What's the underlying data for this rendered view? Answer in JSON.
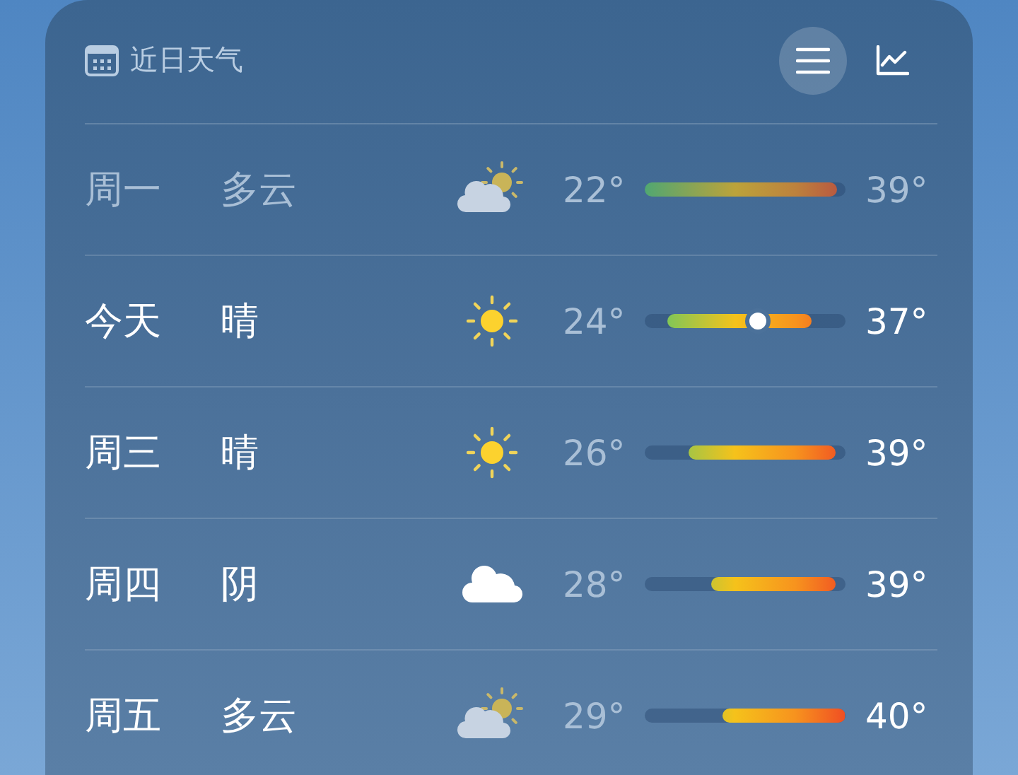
{
  "header": {
    "title": "近日天气",
    "views": [
      {
        "kind": "list",
        "selected": true
      },
      {
        "kind": "chart",
        "selected": false
      }
    ]
  },
  "days": [
    {
      "day": "周一",
      "condition": "多云",
      "kind": "partly-cloudy",
      "low": "22°",
      "high": "39°",
      "past": true
    },
    {
      "day": "今天",
      "condition": "晴",
      "kind": "sunny",
      "low": "24°",
      "high": "37°",
      "past": false,
      "current": {
        "level": 0.56
      }
    },
    {
      "day": "周三",
      "condition": "晴",
      "kind": "sunny",
      "low": "26°",
      "high": "39°",
      "past": false
    },
    {
      "day": "周四",
      "condition": "阴",
      "kind": "cloudy",
      "low": "28°",
      "high": "39°",
      "past": false
    },
    {
      "day": "周五",
      "condition": "多云",
      "kind": "partly-cloudy",
      "low": "29°",
      "high": "40°",
      "past": false
    }
  ]
}
